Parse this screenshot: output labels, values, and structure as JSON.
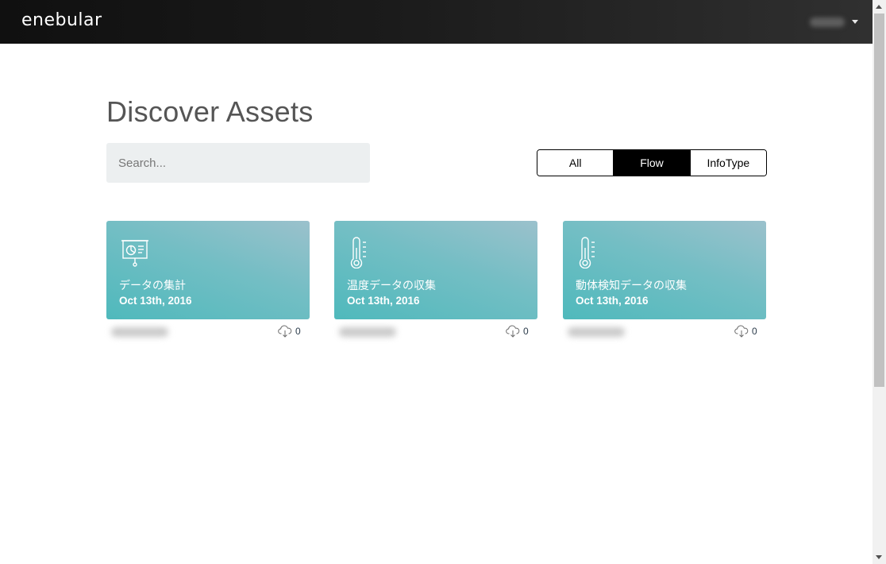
{
  "header": {
    "logo": "enebular",
    "user_menu_icon": "caret-down-icon"
  },
  "page": {
    "title": "Discover Assets"
  },
  "search": {
    "placeholder": "Search...",
    "value": ""
  },
  "filters": [
    {
      "label": "All",
      "active": false
    },
    {
      "label": "Flow",
      "active": true
    },
    {
      "label": "InfoType",
      "active": false
    }
  ],
  "cards": [
    {
      "title": "データの集計",
      "date": "Oct 13th, 2016",
      "downloads": "0",
      "icon": "presentation-chart-icon"
    },
    {
      "title": "温度データの収集",
      "date": "Oct 13th, 2016",
      "downloads": "0",
      "icon": "thermometer-icon"
    },
    {
      "title": "動体検知データの収集",
      "date": "Oct 13th, 2016",
      "downloads": "0",
      "icon": "thermometer-icon"
    }
  ],
  "colors": {
    "header_bg": "#1b1b1b",
    "card_teal": "#5bbcc0",
    "filter_active": "#000000"
  }
}
